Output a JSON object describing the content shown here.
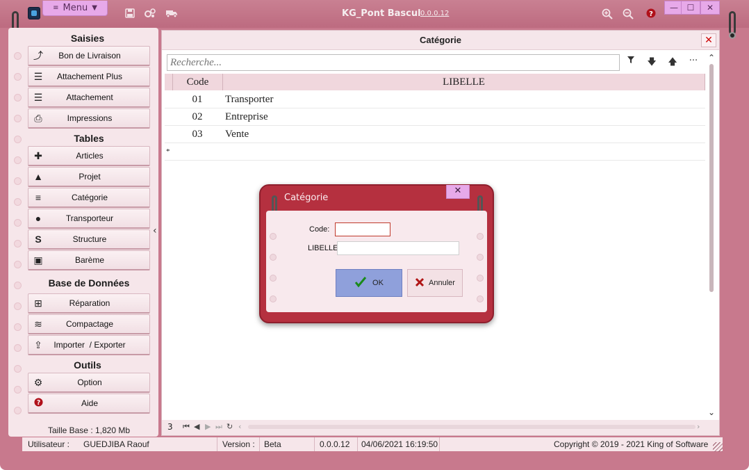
{
  "app": {
    "title": "KG_Pont Bascul",
    "version": "0.0.0.12",
    "menu_label": "Menu",
    "toolbar_icons": [
      "save-icon",
      "settings-icon",
      "truck-icon"
    ],
    "zoom_icons": [
      "zoom-in-icon",
      "zoom-out-icon",
      "help-icon"
    ],
    "window_controls": [
      "minimize",
      "maximize",
      "close"
    ]
  },
  "sidebar": {
    "sections": [
      {
        "title": "Saisies",
        "items": [
          {
            "label": "Bon de Livraison",
            "icon": "share-icon"
          },
          {
            "label": "Attachement Plus",
            "icon": "list-card-icon"
          },
          {
            "label": "Attachement",
            "icon": "list-card-icon"
          },
          {
            "label": "Impressions",
            "icon": "printer-icon"
          }
        ]
      },
      {
        "title": "Tables",
        "items": [
          {
            "label": "Articles",
            "icon": "puzzle-icon"
          },
          {
            "label": "Projet",
            "icon": "road-icon"
          },
          {
            "label": "Catégorie",
            "icon": "numbered-list-icon"
          },
          {
            "label": "Transporteur",
            "icon": "users-icon"
          },
          {
            "label": "Structure",
            "icon": "structure-icon"
          },
          {
            "label": "Barème",
            "icon": "money-icon"
          }
        ]
      },
      {
        "title": "Base de Données",
        "items": [
          {
            "label": "Réparation",
            "icon": "medkit-icon"
          },
          {
            "label": "Compactage",
            "icon": "stack-icon"
          },
          {
            "label": "Importer  / Exporter",
            "icon": "upload-icon"
          }
        ]
      },
      {
        "title": "Outils",
        "items": [
          {
            "label": "Option",
            "icon": "gears-icon"
          },
          {
            "label": "Aide",
            "icon": "help-icon"
          }
        ]
      }
    ],
    "db_size": "Taille Base : 1,820 Mb"
  },
  "main": {
    "title": "Catégorie",
    "search_placeholder": "Recherche...",
    "columns": [
      "Code",
      "LIBELLE"
    ],
    "rows": [
      {
        "code": "01",
        "libelle": "Transporter"
      },
      {
        "code": "02",
        "libelle": "Entreprise"
      },
      {
        "code": "03",
        "libelle": "Vente"
      }
    ],
    "new_row_marker": "*",
    "record_count": "3"
  },
  "dialog": {
    "title": "Catégorie",
    "code_label": "Code:",
    "code_value": "",
    "libelle_label": "LIBELLE",
    "libelle_value": "",
    "ok_label": "OK",
    "cancel_label": "Annuler"
  },
  "status": {
    "user_label": "Utilisateur :",
    "user_value": "GUEDJIBA Raouf",
    "version_label": "Version :",
    "version_value": "Beta",
    "build": "0.0.0.12",
    "datetime": "04/06/2021 16:19:50",
    "copyright": "Copyright © 2019 - 2021 King of Software"
  }
}
